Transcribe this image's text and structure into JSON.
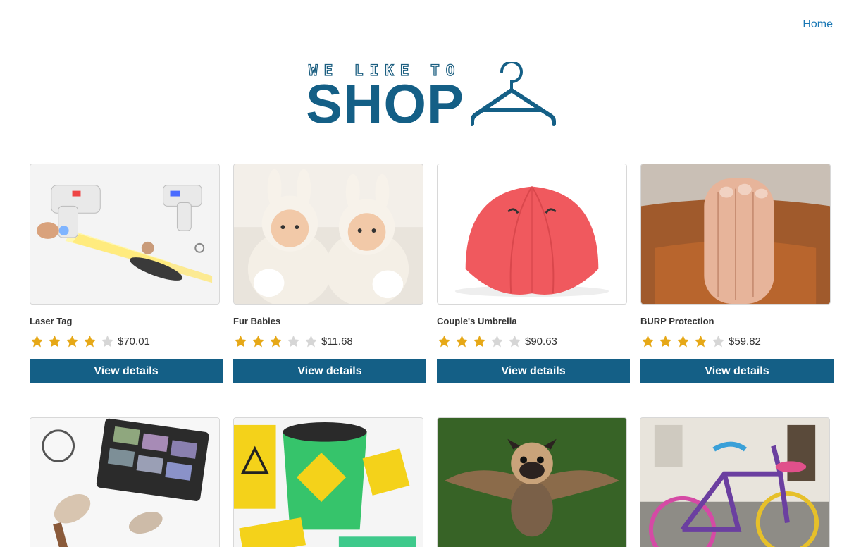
{
  "nav": {
    "home": "Home"
  },
  "logo": {
    "tagline": "WE LIKE TO",
    "word": "SHOP"
  },
  "colors": {
    "brand": "#145f86",
    "link": "#1a78b5",
    "star_on": "#e6a817",
    "star_off": "#d6d6d6"
  },
  "products": [
    {
      "name": "Laser Tag",
      "rating": 4,
      "price": "$70.01",
      "button": "View details"
    },
    {
      "name": "Fur Babies",
      "rating": 3,
      "price": "$11.68",
      "button": "View details"
    },
    {
      "name": "Couple's Umbrella",
      "rating": 3,
      "price": "$90.63",
      "button": "View details"
    },
    {
      "name": "BURP Protection",
      "rating": 4,
      "price": "$59.82",
      "button": "View details"
    }
  ],
  "products_row2": [
    {
      "image": "makeup-image"
    },
    {
      "image": "bucket-of-doom-image"
    },
    {
      "image": "flying-pug-image"
    },
    {
      "image": "yarn-bike-image"
    }
  ]
}
